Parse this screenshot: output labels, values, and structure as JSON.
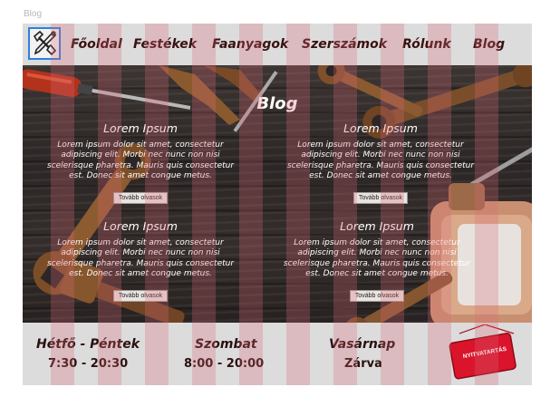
{
  "frame_label": "Blog",
  "nav": {
    "items": [
      "Főoldal",
      "Festékek",
      "Faanyagok",
      "Szerszámok",
      "Rólunk",
      "Blog"
    ],
    "icon": "tools-logo-icon"
  },
  "hero": {
    "title": "Blog",
    "cards": [
      {
        "title": "Lorem Ipsum",
        "body": "Lorem ipsum dolor sit amet, consectetur adipiscing elit. Morbi nec nunc non nisi scelerisque pharetra. Mauris quis consectetur est. Donec sit amet congue metus.",
        "button": "Tovább olvasok"
      },
      {
        "title": "Lorem Ipsum",
        "body": "Lorem ipsum dolor sit amet, consectetur adipiscing elit. Morbi nec nunc non nisi scelerisque pharetra. Mauris quis consectetur est. Donec sit amet congue metus.",
        "button": "Tovább olvasok"
      },
      {
        "title": "Lorem Ipsum",
        "body": "Lorem ipsum dolor sit amet, consectetur adipiscing elit. Morbi nec nunc non nisi scelerisque pharetra. Mauris quis consectetur est. Donec sit amet congue metus.",
        "button": "Tovább olvasok"
      },
      {
        "title": "Lorem Ipsum",
        "body": "Lorem ipsum dolor sit amet, consectetur adipiscing elit. Morbi nec nunc non nisi scelerisque pharetra. Mauris quis consectetur est. Donec sit amet congue metus.",
        "button": "Tovább olvasok"
      }
    ]
  },
  "hours": [
    {
      "day": "Hétfő - Péntek",
      "time": "7:30 - 20:30"
    },
    {
      "day": "Szombat",
      "time": "8:00 - 20:00"
    },
    {
      "day": "Vasárnap",
      "time": "Zárva"
    }
  ],
  "sign": {
    "text": "NYITVATARTÁS"
  },
  "colors": {
    "nav_bg": "#dcdcdc",
    "nav_text": "#3a1010",
    "logo_border": "#2f7fe0",
    "grid_overlay": "#da6978",
    "sign_red": "#d9142b"
  }
}
